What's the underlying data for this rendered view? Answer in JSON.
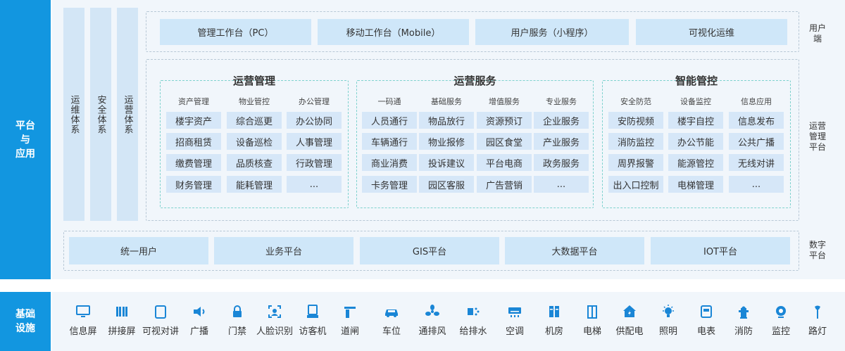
{
  "side_labels": {
    "platform": "平台\n与\n应用",
    "infra": "基础\n设施"
  },
  "systems": [
    "运维体系",
    "安全体系",
    "运营体系"
  ],
  "user_end": {
    "label": "用户\n端",
    "items": [
      "管理工作台（PC）",
      "移动工作台（Mobile）",
      "用户服务（小程序）",
      "可视化运维"
    ]
  },
  "ops_platform": {
    "label": "运营\n管理\n平台",
    "groups": [
      {
        "title": "运营管理",
        "columns": [
          {
            "title": "资产管理",
            "items": [
              "楼宇资产",
              "招商租赁",
              "缴费管理",
              "财务管理"
            ]
          },
          {
            "title": "物业管控",
            "items": [
              "综合巡更",
              "设备巡检",
              "品质核查",
              "能耗管理"
            ]
          },
          {
            "title": "办公管理",
            "items": [
              "办公协同",
              "人事管理",
              "行政管理",
              "..."
            ]
          }
        ]
      },
      {
        "title": "运营服务",
        "columns": [
          {
            "title": "一码通",
            "items": [
              "人员通行",
              "车辆通行",
              "商业消费",
              "卡务管理"
            ]
          },
          {
            "title": "基础服务",
            "items": [
              "物品放行",
              "物业报修",
              "投诉建议",
              "园区客服"
            ]
          },
          {
            "title": "增值服务",
            "items": [
              "资源预订",
              "园区食堂",
              "平台电商",
              "广告营销"
            ]
          },
          {
            "title": "专业服务",
            "items": [
              "企业服务",
              "产业服务",
              "政务服务",
              "..."
            ]
          }
        ]
      },
      {
        "title": "智能管控",
        "columns": [
          {
            "title": "安全防范",
            "items": [
              "安防视频",
              "消防监控",
              "周界报警",
              "出入口控制"
            ]
          },
          {
            "title": "设备监控",
            "items": [
              "楼宇自控",
              "办公节能",
              "能源管控",
              "电梯管理"
            ]
          },
          {
            "title": "信息应用",
            "items": [
              "信息发布",
              "公共广播",
              "无线对讲",
              "..."
            ]
          }
        ]
      }
    ]
  },
  "digital_platform": {
    "label": "数字\n平台",
    "items": [
      "统一用户",
      "业务平台",
      "GIS平台",
      "大数据平台",
      "IOT平台"
    ]
  },
  "infrastructure": [
    {
      "icon": "screen-icon",
      "label": "信息屏"
    },
    {
      "icon": "tiled-screen-icon",
      "label": "拼接屏"
    },
    {
      "icon": "tablet-icon",
      "label": "可视对讲"
    },
    {
      "icon": "speaker-icon",
      "label": "广播"
    },
    {
      "icon": "lock-icon",
      "label": "门禁"
    },
    {
      "icon": "face-scan-icon",
      "label": "人脸识别"
    },
    {
      "icon": "kiosk-icon",
      "label": "访客机"
    },
    {
      "icon": "gate-barrier-icon",
      "label": "道闸"
    },
    {
      "icon": "car-icon",
      "label": "车位"
    },
    {
      "icon": "fan-icon",
      "label": "通排风"
    },
    {
      "icon": "water-pump-icon",
      "label": "给排水"
    },
    {
      "icon": "air-conditioner-icon",
      "label": "空调"
    },
    {
      "icon": "server-room-icon",
      "label": "机房"
    },
    {
      "icon": "elevator-icon",
      "label": "电梯"
    },
    {
      "icon": "power-supply-icon",
      "label": "供配电"
    },
    {
      "icon": "light-bulb-icon",
      "label": "照明"
    },
    {
      "icon": "electric-meter-icon",
      "label": "电表"
    },
    {
      "icon": "fire-hydrant-icon",
      "label": "消防"
    },
    {
      "icon": "camera-icon",
      "label": "监控"
    },
    {
      "icon": "street-light-icon",
      "label": "路灯"
    }
  ],
  "colors": {
    "accent": "#1296e0",
    "icon": "#1a86d6",
    "cell": "#d6e7f8",
    "button": "#cfe7f9",
    "panel": "#f1f6fb"
  }
}
